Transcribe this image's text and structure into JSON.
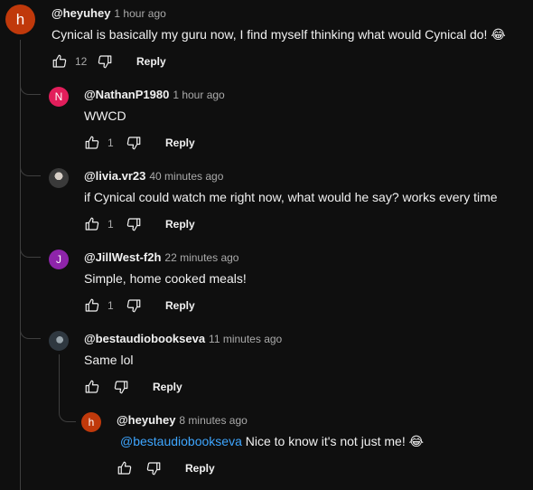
{
  "comments": [
    {
      "author": "@heyuhey",
      "time": "1 hour ago",
      "text": "Cynical is basically my guru now, I find myself thinking what would Cynical do! 😂",
      "likes": "12",
      "reply": "Reply",
      "avatar": {
        "letter": "h",
        "color": "#c0390b"
      }
    },
    {
      "author": "@NathanP1980",
      "time": "1 hour ago",
      "text": "WWCD",
      "likes": "1",
      "reply": "Reply",
      "avatar": {
        "letter": "N",
        "color": "#e21e5b"
      }
    },
    {
      "author": "@livia.vr23",
      "time": "40 minutes ago",
      "text": "if Cynical could watch me right now, what would he say? works every time",
      "likes": "1",
      "reply": "Reply",
      "avatar": {
        "letter": "",
        "color": "#7a7a7a"
      }
    },
    {
      "author": "@JillWest-f2h",
      "time": "22 minutes ago",
      "text": "Simple, home cooked meals!",
      "likes": "1",
      "reply": "Reply",
      "avatar": {
        "letter": "J",
        "color": "#8e24aa"
      }
    },
    {
      "author": "@bestaudiobookseva",
      "time": "11 minutes ago",
      "text": "Same lol",
      "likes": "",
      "reply": "Reply",
      "avatar": {
        "letter": "",
        "color": "#4a5560"
      }
    },
    {
      "author": "@heyuhey",
      "time": "8 minutes ago",
      "mention": "@bestaudiobookseva",
      "text": " Nice to know it's not just me! 😂",
      "likes": "",
      "reply": "Reply",
      "avatar": {
        "letter": "h",
        "color": "#c0390b"
      }
    }
  ]
}
